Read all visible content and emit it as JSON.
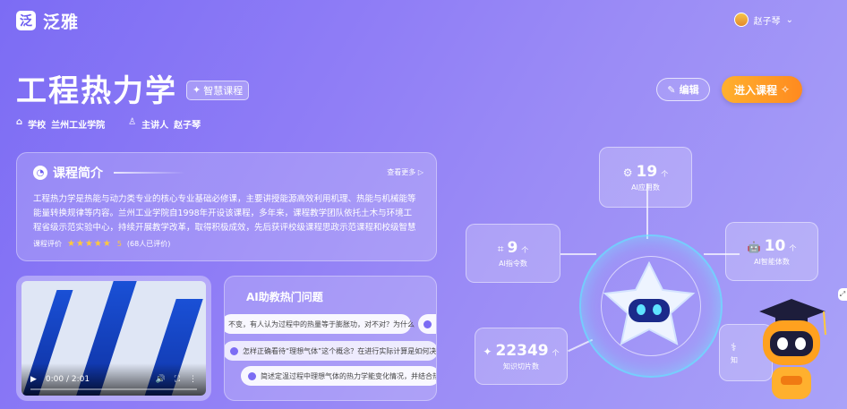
{
  "header": {
    "logo_glyph": "泛",
    "brand": "泛雅",
    "user_name": "赵子琴",
    "user_caret": "⌄"
  },
  "course": {
    "title": "工程热力学",
    "badge": "智慧课程",
    "school_label": "学校",
    "school": "兰州工业学院",
    "lecturer_label": "主讲人",
    "lecturer": "赵子琴"
  },
  "actions": {
    "edit": "编辑",
    "enter": "进入课程"
  },
  "intro": {
    "title": "课程简介",
    "more": "查看更多 ▷",
    "text": "工程热力学是热能与动力类专业的核心专业基础必修课，主要讲授能源高效利用机理、热能与机械能等能量转换规律等内容。兰州工业学院自1998年开设该课程，多年来，课程教学团队依托土木与环境工程省级示范实验中心，持续开展教学改革，取得积极成效，先后获评校级课程思政示范课程和校级智慧课程...",
    "rating_label": "课程评价",
    "stars": "★★★★★",
    "rating": "5",
    "reviews": "(68人已评价)"
  },
  "video": {
    "time": "0:00 / 2:01",
    "play": "▶",
    "volume": "🔊",
    "fullscreen": "⛶",
    "menu": "⋮"
  },
  "faq": {
    "title": "AI助教热门问题",
    "items": [
      "不变，有人认为过程中的热量等于膨胀功，对不对？为什么",
      "怎样正确看待“理想气体”这个概念？在进行实际计算是如何决",
      "简述定温过程中理想气体的热力学能变化情况，并结合热"
    ]
  },
  "stats": {
    "ai_apps": {
      "value": "19",
      "unit": "个",
      "label": "AI应用数",
      "icon": "⚙"
    },
    "ai_instructions": {
      "value": "9",
      "unit": "个",
      "label": "AI指令数",
      "icon": "⌗"
    },
    "ai_agents": {
      "value": "10",
      "unit": "个",
      "label": "AI智能体数",
      "icon": "🤖"
    },
    "slices": {
      "value": "22349",
      "unit": "个",
      "label": "知识切片数",
      "icon": "✦"
    },
    "partial": {
      "label": "知",
      "icon": "⚕"
    }
  },
  "colors": {
    "accent": "#7c6cf4",
    "orange": "#ff9a24",
    "star": "#ffc93c"
  }
}
